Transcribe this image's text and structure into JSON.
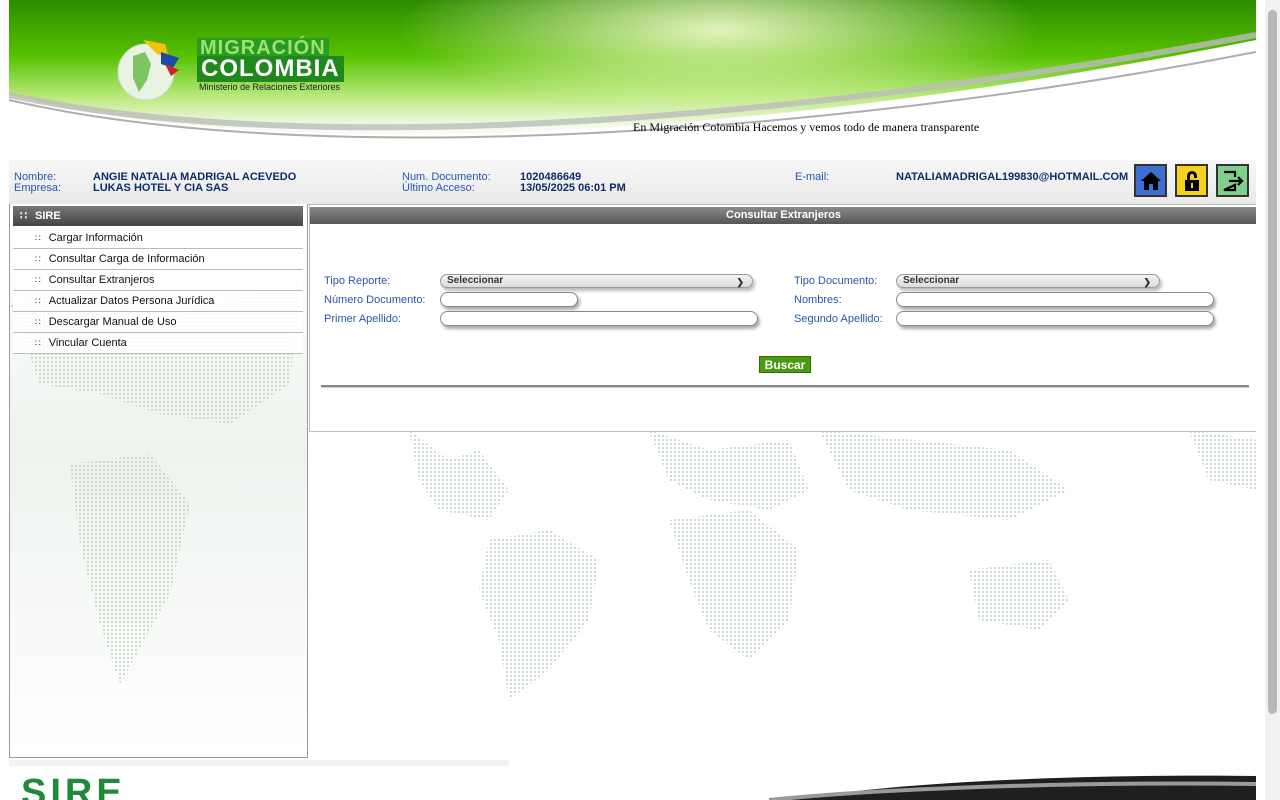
{
  "header": {
    "logo_line1": "MIGRACIÓN",
    "logo_line2": "COLOMBIA",
    "logo_line3": "Ministerio de Relaciones Exteriores",
    "tagline": "En Migración Colombia Hacemos y vemos todo de manera transparente"
  },
  "user": {
    "nombre_label": "Nombre:",
    "nombre": "ANGIE NATALIA MADRIGAL ACEVEDO",
    "empresa_label": "Empresa:",
    "empresa": "LUKAS HOTEL Y CIA SAS",
    "doc_label": "Num. Documento:",
    "doc": "1020486649",
    "acceso_label": "Último Acceso:",
    "acceso": "13/05/2025 06:01 PM",
    "email_label": "E-mail:",
    "email": "NATALIAMADRIGAL199830@HOTMAIL.COM"
  },
  "toolbar_icons": [
    "home-icon",
    "lock-icon",
    "logout-icon"
  ],
  "colors": {
    "brand_green": "#4a9a12",
    "label_blue": "#2a56a8",
    "header_gray": "#555555"
  },
  "sidebar": {
    "title": "SIRE",
    "items": [
      {
        "label": "Cargar Información"
      },
      {
        "label": "Consultar Carga de Información"
      },
      {
        "label": "Consultar Extranjeros"
      },
      {
        "label": "Actualizar Datos Persona Jurídica"
      },
      {
        "label": "Descargar Manual de Uso"
      },
      {
        "label": "Vincular Cuenta"
      }
    ]
  },
  "panel": {
    "title": "Consultar Extranjeros",
    "tipo_reporte_label": "Tipo Reporte:",
    "tipo_reporte_value": "Seleccionar",
    "tipo_documento_label": "Tipo Documento:",
    "tipo_documento_value": "Seleccionar",
    "numero_documento_label": "Número Documento:",
    "nombres_label": "Nombres:",
    "primer_apellido_label": "Primer Apellido:",
    "segundo_apellido_label": "Segundo Apellido:",
    "buscar_label": "Buscar"
  },
  "footer": {
    "logo_text": "SIRE"
  }
}
